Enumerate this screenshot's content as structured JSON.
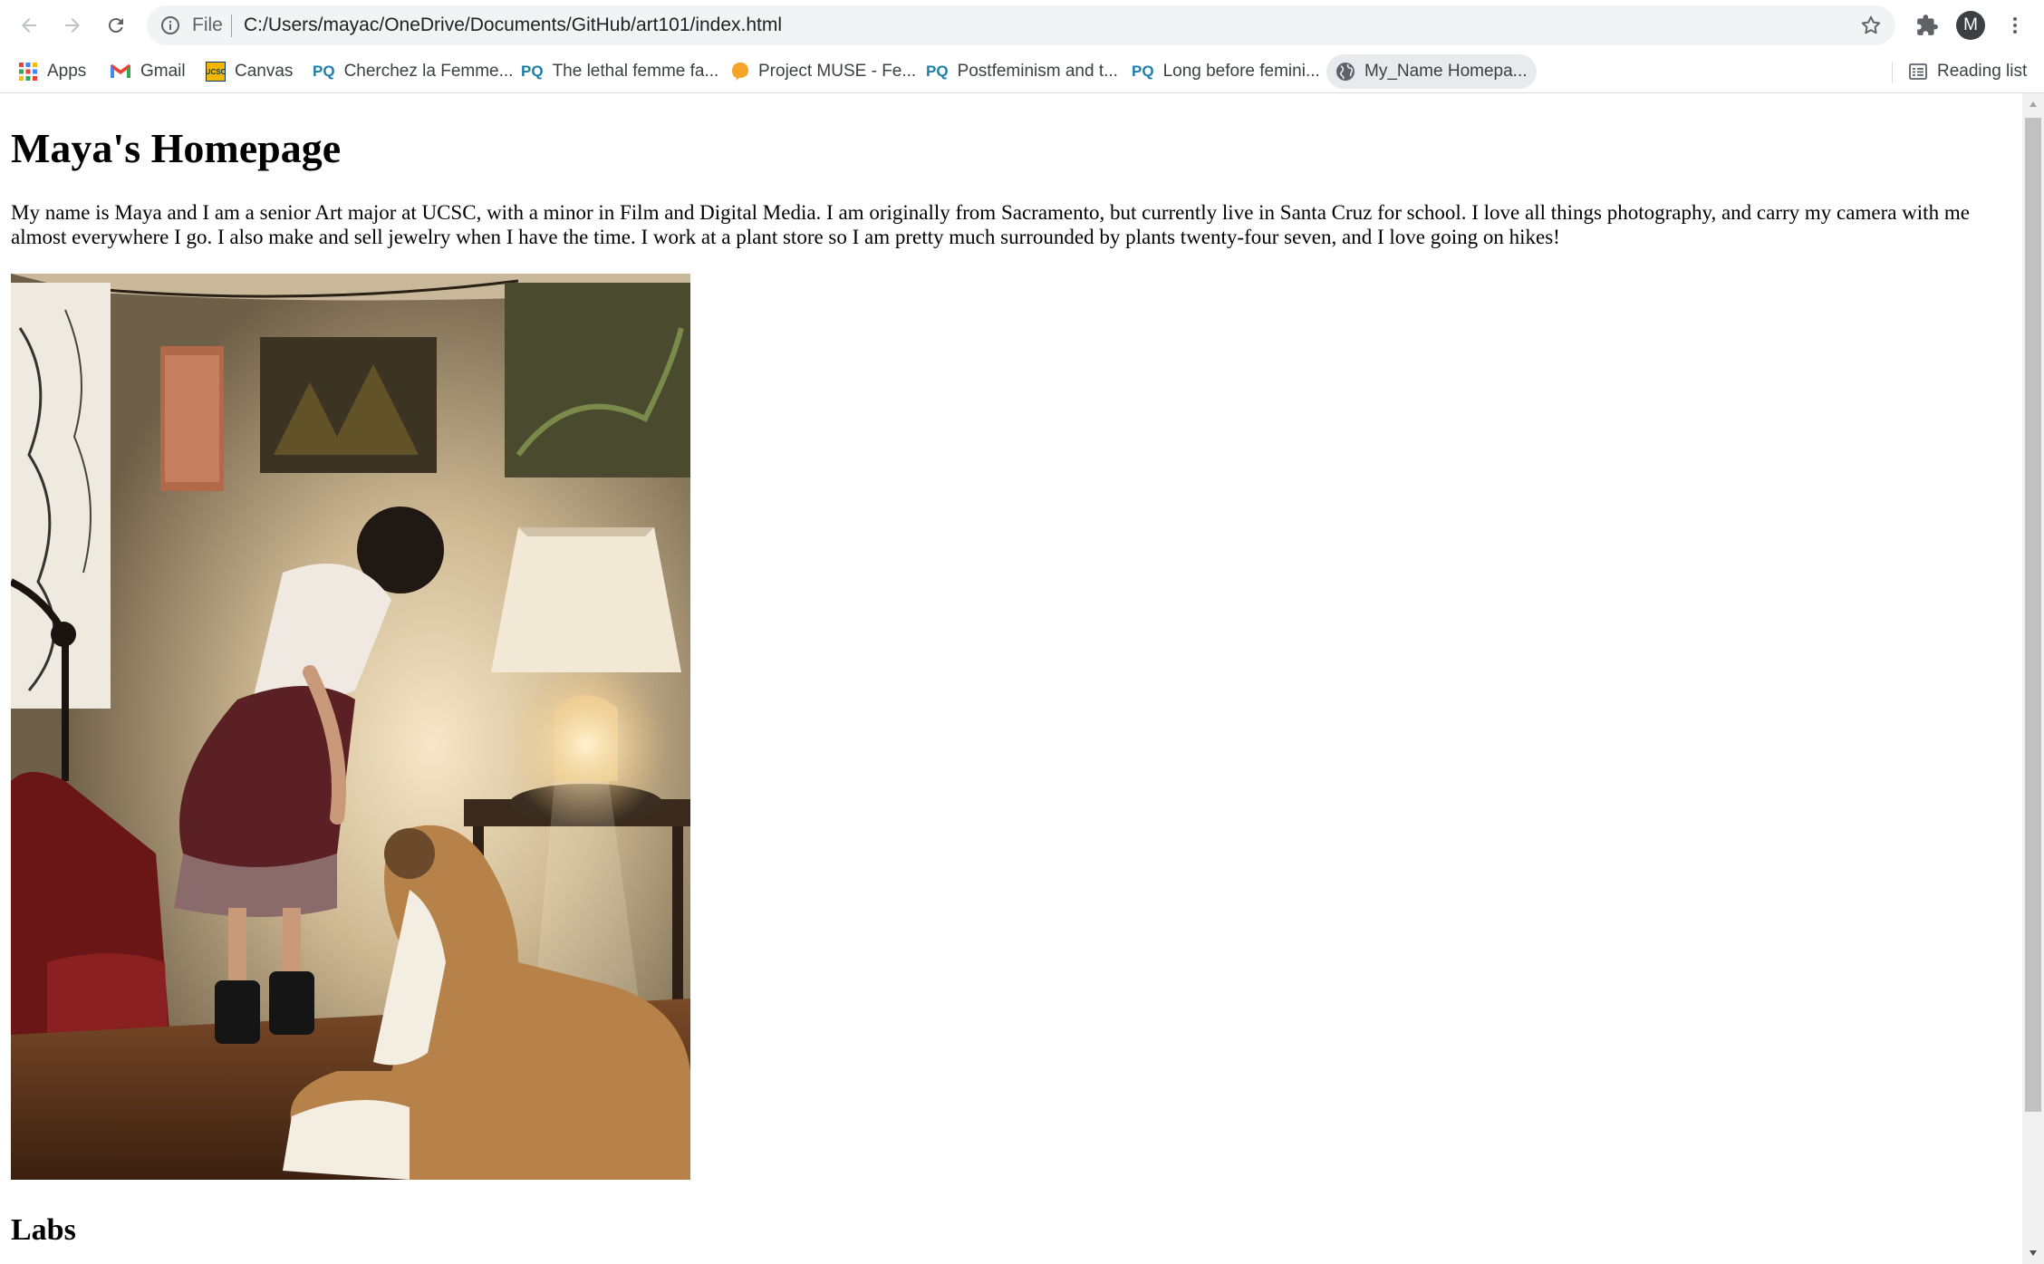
{
  "toolbar": {
    "back_icon": "arrow-left-icon",
    "forward_icon": "arrow-right-icon",
    "reload_icon": "reload-icon",
    "scheme_label": "File",
    "url": "C:/Users/mayac/OneDrive/Documents/GitHub/art101/index.html",
    "profile_initial": "M"
  },
  "bookmarks": {
    "items": [
      {
        "label": "Apps",
        "icon": "apps-grid-icon"
      },
      {
        "label": "Gmail",
        "icon": "gmail-icon"
      },
      {
        "label": "Canvas",
        "icon": "ucsc-icon"
      },
      {
        "label": "Cherchez la Femme...",
        "icon": "pq-icon"
      },
      {
        "label": "The lethal femme fa...",
        "icon": "pq-icon"
      },
      {
        "label": "Project MUSE - Fe...",
        "icon": "project-muse-icon"
      },
      {
        "label": "Postfeminism and t...",
        "icon": "pq-icon"
      },
      {
        "label": "Long before femini...",
        "icon": "pq-icon"
      },
      {
        "label": "My_Name Homepa...",
        "icon": "globe-icon"
      }
    ],
    "pq_text": "PQ",
    "ucsc_text": "UCSC",
    "reading_list": "Reading list"
  },
  "page": {
    "title": "Maya's Homepage",
    "bio": "My name is Maya and I am a senior Art major at UCSC, with a minor in Film and Digital Media. I am originally from Sacramento, but currently live in Santa Cruz for school. I love all things photography, and carry my camera with me almost everywhere I go. I also make and sell jewelry when I have the time. I work at a plant store so I am pretty much surrounded by plants twenty-four seven, and I love going on hikes!",
    "section_heading": "Labs"
  },
  "colors": {
    "omnibox_bg": "#f1f3f4",
    "pq_blue": "#1a7fa8",
    "active_bookmark_bg": "#e8eaed"
  }
}
